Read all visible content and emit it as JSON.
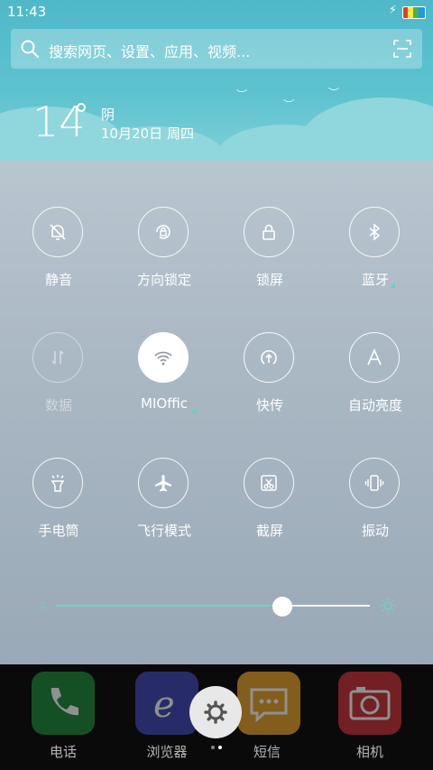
{
  "status": {
    "time": "11:43"
  },
  "search": {
    "placeholder": "搜索网页、设置、应用、视频..."
  },
  "weather": {
    "temperature": "14",
    "degree": "°",
    "condition": "阴",
    "date": "10月20日 周四"
  },
  "toggles": [
    {
      "label": "静音",
      "icon": "bell-off-icon",
      "active": false
    },
    {
      "label": "方向锁定",
      "icon": "rotation-lock-icon",
      "active": false
    },
    {
      "label": "锁屏",
      "icon": "lock-icon",
      "active": false
    },
    {
      "label": "蓝牙",
      "icon": "bluetooth-icon",
      "active": false
    },
    {
      "label": "数据",
      "icon": "mobile-data-icon",
      "active": false
    },
    {
      "label": "MIOffic",
      "icon": "wifi-icon",
      "active": true
    },
    {
      "label": "快传",
      "icon": "transfer-icon",
      "active": false
    },
    {
      "label": "自动亮度",
      "icon": "auto-brightness-icon",
      "active": false
    },
    {
      "label": "手电筒",
      "icon": "flashlight-icon",
      "active": false
    },
    {
      "label": "飞行模式",
      "icon": "airplane-icon",
      "active": false
    },
    {
      "label": "截屏",
      "icon": "screenshot-icon",
      "active": false
    },
    {
      "label": "振动",
      "icon": "vibrate-icon",
      "active": false
    }
  ],
  "brightness": {
    "level": 0.72
  },
  "dock": [
    {
      "label": "电话",
      "icon": "phone-icon",
      "color": "#1e8a3c"
    },
    {
      "label": "浏览器",
      "icon": "browser-icon",
      "color": "#3f49b8"
    },
    {
      "label": "短信",
      "icon": "message-icon",
      "color": "#e6a22a"
    },
    {
      "label": "相机",
      "icon": "camera-icon",
      "color": "#c8323a"
    }
  ],
  "colors": {
    "accent": "#6fd3c4",
    "header": "#5ec3cf"
  }
}
